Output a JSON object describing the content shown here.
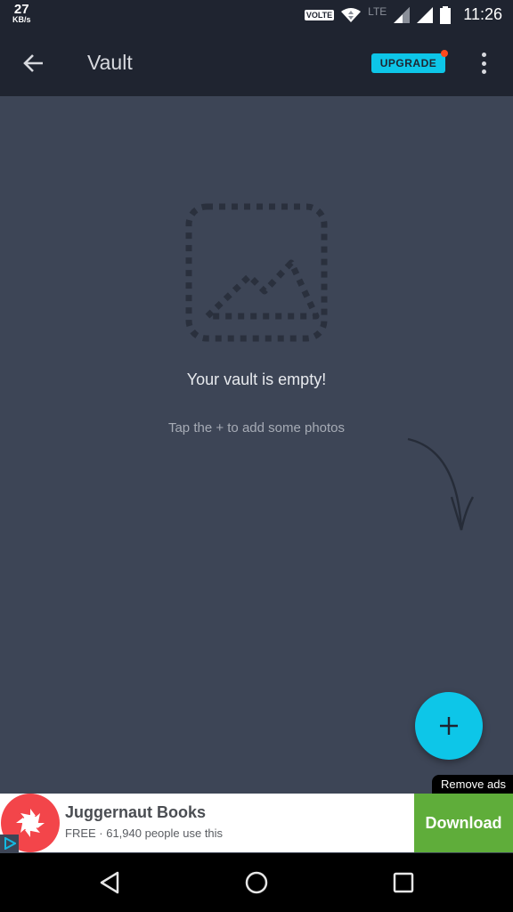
{
  "status_bar": {
    "net_speed_value": "27",
    "net_speed_unit": "KB/s",
    "volte_label": "VOLTE",
    "lte_label": "LTE",
    "time": "11:26",
    "icons": [
      "wifi-icon",
      "signal-icon",
      "signal-icon",
      "battery-icon"
    ]
  },
  "app_bar": {
    "back_icon": "arrow-left-icon",
    "title": "Vault",
    "upgrade_label": "UPGRADE",
    "upgrade_badge_color": "#ff4a1c",
    "more_icon": "more-vertical-icon"
  },
  "empty_state": {
    "icon": "image-placeholder-icon",
    "title": "Your vault is empty!",
    "subtitle": "Tap the + to add some photos",
    "hint_icon": "curved-arrow-icon"
  },
  "fab": {
    "icon": "plus-icon",
    "label": "+"
  },
  "ad": {
    "remove_ads_label": "Remove ads",
    "app_name": "Juggernaut Books",
    "subtitle": "FREE · 61,940 people use this",
    "cta_label": "Download",
    "logo_icon": "juggernaut-logo-icon",
    "adchoices_icon": "adchoices-icon"
  },
  "nav_bar": {
    "back_icon": "nav-back-icon",
    "home_icon": "nav-home-icon",
    "recents_icon": "nav-recents-icon"
  },
  "colors": {
    "accent": "#0dc6e8",
    "toolbar": "#1f2430",
    "background": "#3d4556",
    "ad_cta": "#5fad3a",
    "ad_logo": "#f3454a"
  }
}
